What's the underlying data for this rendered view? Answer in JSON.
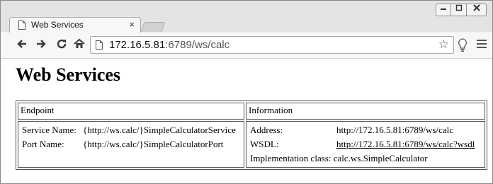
{
  "browser": {
    "tab_title": "Web Services",
    "tab_close": "×",
    "url_host": "172.16.5.81",
    "url_rest": ":6789/ws/calc"
  },
  "page": {
    "title": "Web Services",
    "columns": [
      "Endpoint",
      "Information"
    ],
    "endpoint": {
      "service_name_label": "Service Name:",
      "service_name_value": "{http://ws.calc/}SimpleCalculatorService",
      "port_name_label": "Port Name:",
      "port_name_value": "{http://ws.calc/}SimpleCalculatorPort"
    },
    "information": {
      "address_label": "Address:",
      "address_value": "http://172.16.5.81:6789/ws/calc",
      "wsdl_label": "WSDL:",
      "wsdl_value": "http://172.16.5.81:6789/ws/calc?wsdl",
      "impl_label": "Implementation class:",
      "impl_value": "calc.ws.SimpleCalculator"
    }
  }
}
